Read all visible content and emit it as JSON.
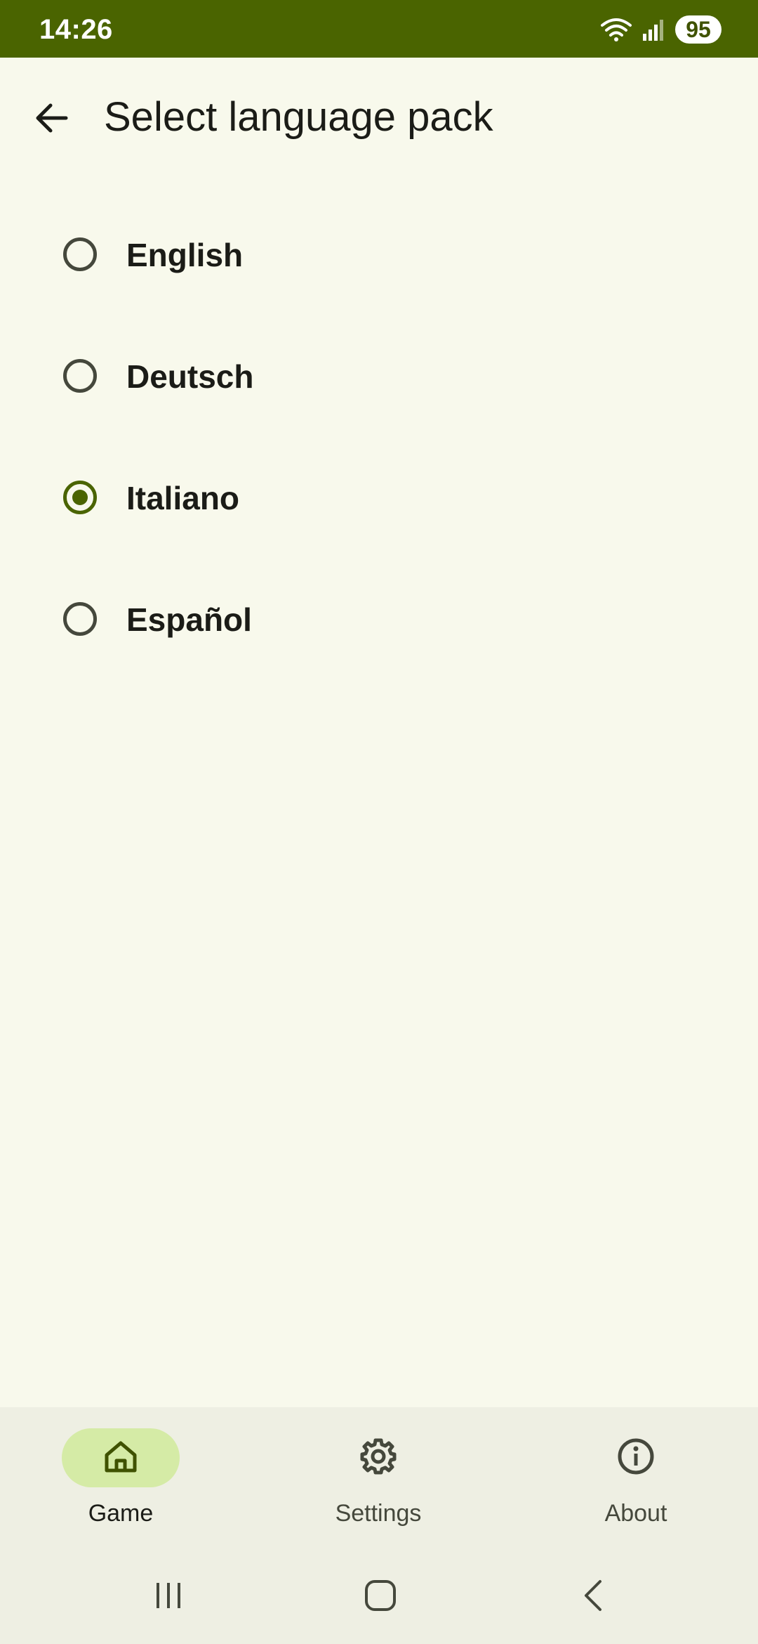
{
  "status_bar": {
    "time": "14:26",
    "battery": "95",
    "icons": [
      "wifi-icon",
      "signal-icon",
      "battery-icon"
    ]
  },
  "app_bar": {
    "title": "Select language pack",
    "back_icon": "arrow-back-icon"
  },
  "languages": {
    "items": [
      {
        "label": "English",
        "selected": false
      },
      {
        "label": "Deutsch",
        "selected": false
      },
      {
        "label": "Italiano",
        "selected": true
      },
      {
        "label": "Español",
        "selected": false
      }
    ]
  },
  "bottom_nav": {
    "items": [
      {
        "label": "Game",
        "icon": "home-icon",
        "active": true
      },
      {
        "label": "Settings",
        "icon": "gear-icon",
        "active": false
      },
      {
        "label": "About",
        "icon": "info-icon",
        "active": false
      }
    ]
  },
  "colors": {
    "primary": "#4a6400",
    "background": "#f8f9ec",
    "nav_background": "#eeefe3",
    "active_indicator": "#d5eba6"
  }
}
